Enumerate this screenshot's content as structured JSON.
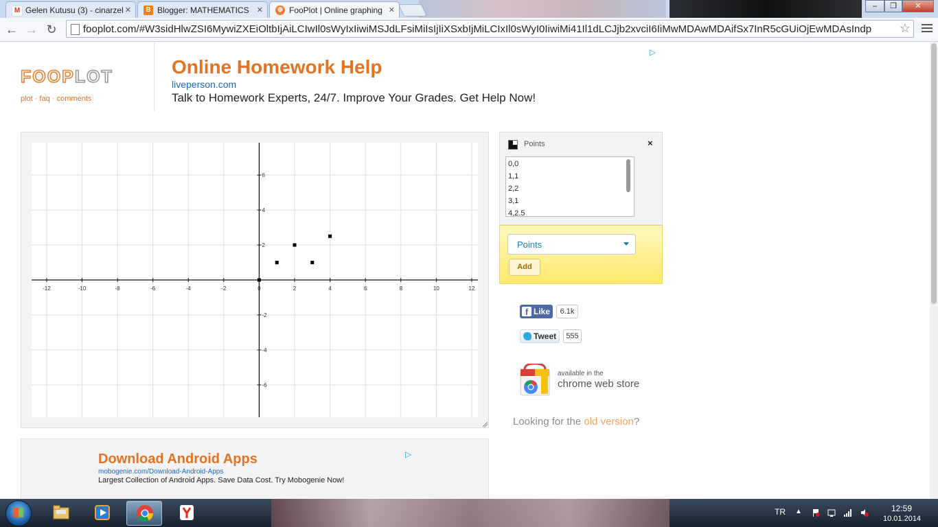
{
  "browser": {
    "tabs": [
      {
        "title": "Gelen Kutusu (3) - cinarzel",
        "icon": "gmail-icon"
      },
      {
        "title": "Blogger: MATHEMATICS",
        "icon": "blogger-icon"
      },
      {
        "title": "FooPlot | Online graphing",
        "icon": "fooplot-icon"
      }
    ],
    "url": "fooplot.com/#W3sidHlwZSI6MywiZXEiOltbIjAiLCIwIl0sWyIxIiwiMSJdLFsiMiIsIjIiXSxbIjMiLCIxIl0sWyI0IiwiMi41Il1dLCJjb2xvciI6IiMwMDAwMDAifSx7InR5cGUiOjEwMDAsIndp"
  },
  "site": {
    "logo_foo": "FOOP",
    "logo_plot": "LOT",
    "nav": {
      "plot": "plot",
      "faq": "faq",
      "comments": "comments",
      "sep": "·"
    }
  },
  "top_ad": {
    "title": "Online Homework Help",
    "url": "liveperson.com",
    "text": "Talk to Homework Experts, 24/7. Improve Your Grades. Get Help Now!",
    "choice_icon": "adchoices-icon"
  },
  "chart_data": {
    "type": "scatter",
    "x_ticks": [
      -12,
      -10,
      -8,
      -6,
      -4,
      -2,
      0,
      2,
      4,
      6,
      8,
      10,
      12
    ],
    "y_ticks": [
      6,
      4,
      2,
      -2,
      -4,
      -6
    ],
    "xlim": [
      -12.85,
      12.35
    ],
    "ylim": [
      -7.85,
      7.85
    ],
    "grid": true,
    "series": [
      {
        "points": [
          [
            0,
            0
          ],
          [
            1,
            1
          ],
          [
            2,
            2
          ],
          [
            3,
            1
          ],
          [
            4,
            2.5
          ]
        ],
        "color": "#000000"
      }
    ]
  },
  "panel": {
    "label": "Points",
    "close": "×",
    "points_text": [
      "0,0",
      "1,1",
      "2,2",
      "3,1",
      "4,2.5"
    ],
    "type_select": "Points",
    "add_label": "Add"
  },
  "social": {
    "like_label": "Like",
    "like_count": "6.1k",
    "tweet_label": "Tweet",
    "tweet_count": "555"
  },
  "chrome_store": {
    "small": "available in the",
    "big": "chrome web store"
  },
  "old_version": {
    "prefix": "Looking for the ",
    "link": "old version",
    "suffix": "?"
  },
  "bottom_ad": {
    "title": "Download Android Apps",
    "url": "mobogenie.com/Download-Android-Apps",
    "text": "Largest Collection of Android Apps. Save Data Cost. Try Mobogenie Now!"
  },
  "taskbar": {
    "lang": "TR",
    "time": "12:59",
    "date": "10.01.2014"
  },
  "colors": {
    "accent": "#e37224",
    "link": "#1a66bb",
    "panel_yellow": "#ffe96a"
  }
}
